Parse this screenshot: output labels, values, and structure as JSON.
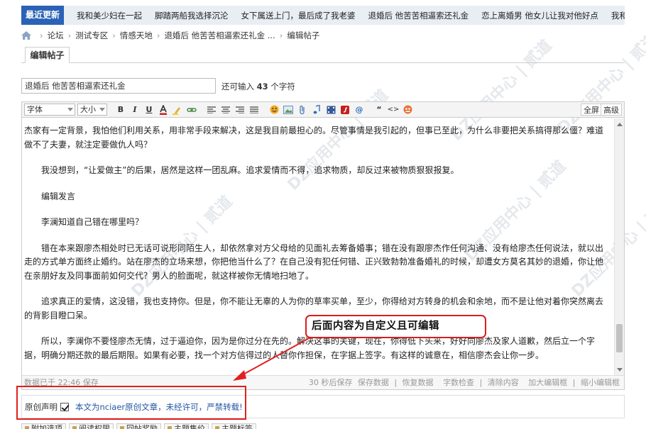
{
  "newsbar": {
    "tag": "最近更新",
    "items": [
      "我和美少妇在一起",
      "脚踏两船我选择沉沦",
      "女下属送上门，最后成了我老婆",
      "退婚后 他苦苦相逼索还礼金",
      "恋上离婚男 他女儿让我对他好点",
      "我和女友的第一次啪啪"
    ]
  },
  "breadcrumb": {
    "items": [
      "论坛",
      "测试专区",
      "情感天地",
      "退婚后 他苦苦相逼索还礼金 ...",
      "编辑帖子"
    ]
  },
  "tab": {
    "label": "编辑帖子"
  },
  "subject": {
    "value": "退婚后 他苦苦相逼索还礼金",
    "counter_prefix": "还可输入",
    "counter_value": "43",
    "counter_suffix": "个字符"
  },
  "toolbar": {
    "font_select": "字体",
    "size_select": "大小",
    "bold": "B",
    "italic": "I",
    "underline": "U",
    "fullscreen": "全屏",
    "advanced": "高级"
  },
  "content": {
    "paragraphs": [
      "杰家有一定背景，我怕他们利用关系，用非常手段来解决，这是我目前最担心的。尽管事情是我引起的，但事已至此，为什么非要把关系搞得那么僵？难道做不了夫妻，就注定要做仇人吗？",
      "我没想到，“让爱做主”的后果，居然是这样一团乱麻。追求爱情而不得，追求物质，却反过来被物质狠狠报复。",
      "编辑发言",
      "李澜知道自己错在哪里吗？",
      "错在本来跟廖杰相处时已无话可说形同陌生人，却依然拿对方父母给的见面礼去筹备婚事；错在没有跟廖杰作任何沟通、没有给廖杰任何说法，就以出走的方式单方面终止婚约。站在廖杰的立场来想，你把他当什么了？在自己没有犯任何错、正兴致勃勃准备婚礼的时候，却遭女方莫名其妙的退婚，你让他在亲朋好友及同事面前如何交代？男人的脸面呢，就这样被你无情地扫地了。",
      "追求真正的爱情，这没错，我也支持你。但是，你不能让无辜的人为你的草率买单，至少，你得给对方转身的机会和余地，而不是让他对着你突然离去的背影目瞪口呆。",
      "所以，李澜你不要怪廖杰无情，过于逼迫你，因为是你过分在先的。解决这事的关键，现在，你得低下头来，好好向廖杰及家人道歉，然后立一个字据，明确分期还款的最后期限。如果有必要，找一个对方信得过的人替你作担保，在字据上签字。有这样的诚意在，相信廖杰会让你一步。"
    ]
  },
  "statusbar": {
    "saved": "数据已于 22:46 保存",
    "autosave": "30 秒后保存",
    "save_data": "保存数据",
    "restore_data": "恢复数据",
    "check_length": "字数检查",
    "clear_content": "清除内容",
    "enlarge": "加大编辑框",
    "shrink": "缩小编辑框"
  },
  "declaration": {
    "label": "原创声明",
    "text": "本文为nciaer原创文章，未经许可，严禁转载!"
  },
  "bottom_tabs": [
    "附加选项",
    "阅读权限",
    "回帖奖励",
    "主题售价",
    "主题标签"
  ],
  "callout": {
    "text": "后面内容为自定义且可编辑"
  },
  "watermark": {
    "text": "DZ应用中心 | 贰道"
  },
  "colors": {
    "accent_blue": "#2a62b5",
    "annotation_red": "#e02020"
  }
}
